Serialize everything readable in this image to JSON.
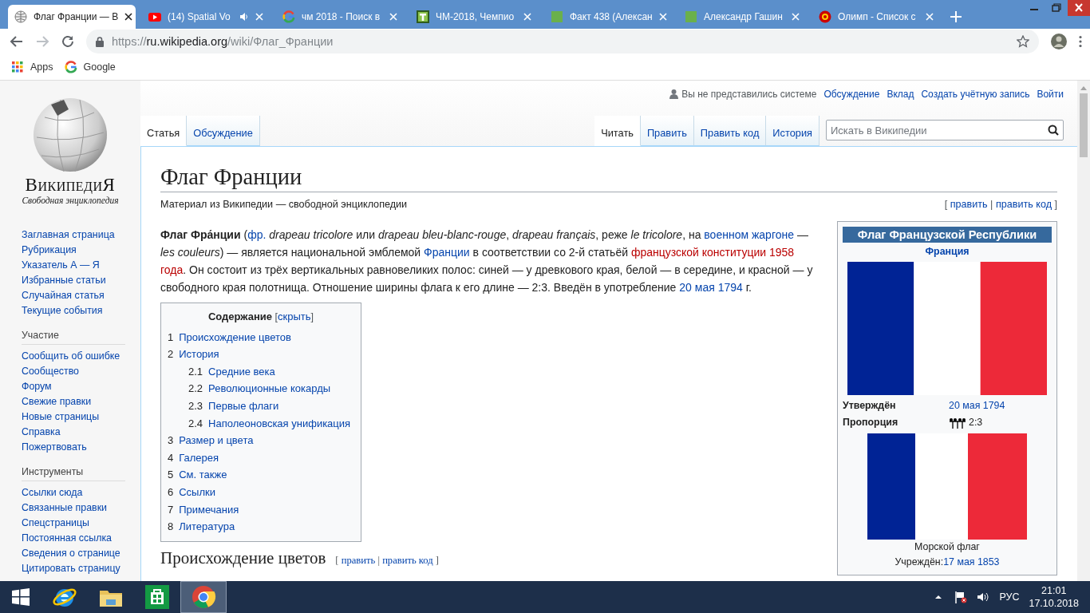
{
  "browser": {
    "tabs": [
      {
        "title": "Флаг Франции — В",
        "kind": "globe",
        "audio": false,
        "selected": true
      },
      {
        "title": "(14) Spatial Vo",
        "kind": "video",
        "audio": true,
        "selected": false
      },
      {
        "title": "чм 2018 - Поиск в",
        "kind": "g",
        "audio": false,
        "selected": false
      },
      {
        "title": "ЧМ-2018, Чемпио",
        "kind": "tile",
        "audio": false,
        "selected": false
      },
      {
        "title": "Факт 438 (Алексан",
        "kind": "square",
        "audio": false,
        "selected": false
      },
      {
        "title": "Александр Гашин",
        "kind": "square",
        "audio": false,
        "selected": false
      },
      {
        "title": "Олимп - Список с",
        "kind": "emblem",
        "audio": false,
        "selected": false
      }
    ],
    "address": {
      "scheme": "https://",
      "host": "ru.wikipedia.org",
      "path": "/wiki/Флаг_Франции"
    },
    "bookmarks": [
      {
        "label": "Apps",
        "kind": "apps"
      },
      {
        "label": "Google",
        "kind": "g"
      }
    ]
  },
  "wiki": {
    "logo": {
      "wordmark": "ВикипедиЯ",
      "tagline": "Свободная энциклопедия"
    },
    "personal": {
      "status": "Вы не представились системе",
      "links": [
        "Обсуждение",
        "Вклад",
        "Создать учётную запись",
        "Войти"
      ]
    },
    "left_tabs": [
      {
        "label": "Статья",
        "selected": true
      },
      {
        "label": "Обсуждение",
        "selected": false
      }
    ],
    "right_tabs": [
      {
        "label": "Читать",
        "selected": true
      },
      {
        "label": "Править",
        "selected": false
      },
      {
        "label": "Править код",
        "selected": false
      },
      {
        "label": "История",
        "selected": false
      }
    ],
    "search": {
      "placeholder": "Искать в Википедии"
    },
    "sidebar": {
      "nav": [
        "Заглавная страница",
        "Рубрикация",
        "Указатель А — Я",
        "Избранные статьи",
        "Случайная статья",
        "Текущие события"
      ],
      "portals": [
        {
          "heading": "Участие",
          "items": [
            "Сообщить об ошибке",
            "Сообщество",
            "Форум",
            "Свежие правки",
            "Новые страницы",
            "Справка",
            "Пожертвовать"
          ]
        },
        {
          "heading": "Инструменты",
          "items": [
            "Ссылки сюда",
            "Связанные правки",
            "Спецстраницы",
            "Постоянная ссылка",
            "Сведения о странице",
            "Цитировать страницу"
          ]
        }
      ]
    },
    "article": {
      "title": "Флаг Франции",
      "subtitle": "Материал из Википедии — свободной энциклопедии",
      "edit_links": {
        "open": "[",
        "edit": "править",
        "separator": "|",
        "source": "править код",
        "close": "]"
      },
      "lead": [
        {
          "kind": "text",
          "text": "**Флаг Фра́нции** ("
        },
        {
          "kind": "link",
          "text": "фр."
        },
        {
          "kind": "text",
          "text": " *drapeau tricolore* или *drapeau bleu-blanc-rouge*, *drapeau français*, реже *le tricolore*, на "
        },
        {
          "kind": "link",
          "text": "военном жаргоне"
        },
        {
          "kind": "text",
          "text": " — *les couleurs*) — является национальной эмблемой "
        },
        {
          "kind": "link",
          "text": "Франции"
        },
        {
          "kind": "text",
          "text": " в соответствии со 2-й статьёй "
        },
        {
          "kind": "redlink",
          "text": "французской конституции 1958",
          "space_before": false
        },
        {
          "kind": "redlink",
          "text": "года",
          "space_before": true
        },
        {
          "kind": "text",
          "text": ". Он состоит из трёх вертикальных равновеликих полос: синей — у древкового края, белой — в середине, и красной — у свободного края полотнища. Отношение ширины флага к его длине — 2:3. Введён в употребление "
        },
        {
          "kind": "link",
          "text": "20 мая 1794"
        },
        {
          "kind": "text",
          "text": " г."
        }
      ],
      "toc": {
        "title": "Содержание",
        "toggle_open": "[",
        "toggle": "скрыть",
        "toggle_close": "]",
        "items": [
          {
            "number": "1",
            "label": "Происхождение цветов"
          },
          {
            "number": "2",
            "label": "История",
            "children": [
              {
                "number": "2.1",
                "label": "Средние века"
              },
              {
                "number": "2.2",
                "label": "Революционные кокарды"
              },
              {
                "number": "2.3",
                "label": "Первые флаги"
              },
              {
                "number": "2.4",
                "label": "Наполеоновская унификация"
              }
            ]
          },
          {
            "number": "3",
            "label": "Размер и цвета"
          },
          {
            "number": "4",
            "label": "Галерея"
          },
          {
            "number": "5",
            "label": "См. также"
          },
          {
            "number": "6",
            "label": "Ссылки"
          },
          {
            "number": "7",
            "label": "Примечания"
          },
          {
            "number": "8",
            "label": "Литература"
          }
        ]
      },
      "section": {
        "title": "Происхождение цветов",
        "edit_links": {
          "open": "[",
          "edit": "править",
          "separator": "|",
          "source": "править код",
          "close": "]"
        }
      },
      "infobox": {
        "title": "Флаг Французской Республики",
        "subtitle": "Франция",
        "rows": [
          {
            "label": "Утверждён",
            "value": "20 мая 1794",
            "kind": "link"
          },
          {
            "label": "Пропорция",
            "value": "2:3",
            "kind": "proportion"
          }
        ],
        "second_flag": {
          "caption": "Морской флаг",
          "established_label": "Учреждён:",
          "established_date": "17 мая 1853"
        }
      }
    }
  },
  "taskbar": {
    "apps": [
      {
        "kind": "ie",
        "selected": false
      },
      {
        "kind": "explorer",
        "selected": false
      },
      {
        "kind": "store",
        "selected": false
      },
      {
        "kind": "chrome",
        "selected": true
      }
    ],
    "language": "РУС",
    "time": "21:01",
    "date": "17.10.2018"
  }
}
